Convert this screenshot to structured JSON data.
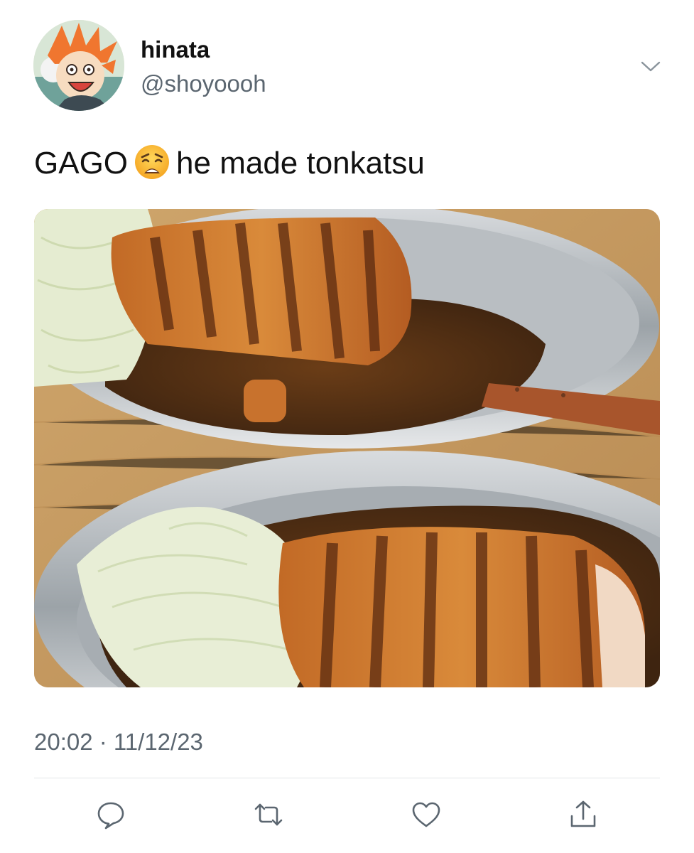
{
  "tweet": {
    "author": {
      "name": "hinata",
      "handle": "@shoyoooh",
      "avatar": "anime-character-avatar"
    },
    "text_before_emoji": "GAGO",
    "emoji": "weary-face",
    "text_after_emoji": "he made tonkatsu",
    "media": {
      "description_icon": "photo-tonkatsu-curry"
    },
    "timestamp": "20:02 · 11/12/23",
    "more_icon": "chevron-down-icon"
  },
  "actions": [
    {
      "name": "reply",
      "icon": "reply-icon"
    },
    {
      "name": "retweet",
      "icon": "retweet-icon"
    },
    {
      "name": "like",
      "icon": "heart-icon"
    },
    {
      "name": "share",
      "icon": "share-icon"
    }
  ],
  "colors": {
    "text": "#111111",
    "secondary": "#5b6670",
    "divider": "#e3e6e8"
  }
}
